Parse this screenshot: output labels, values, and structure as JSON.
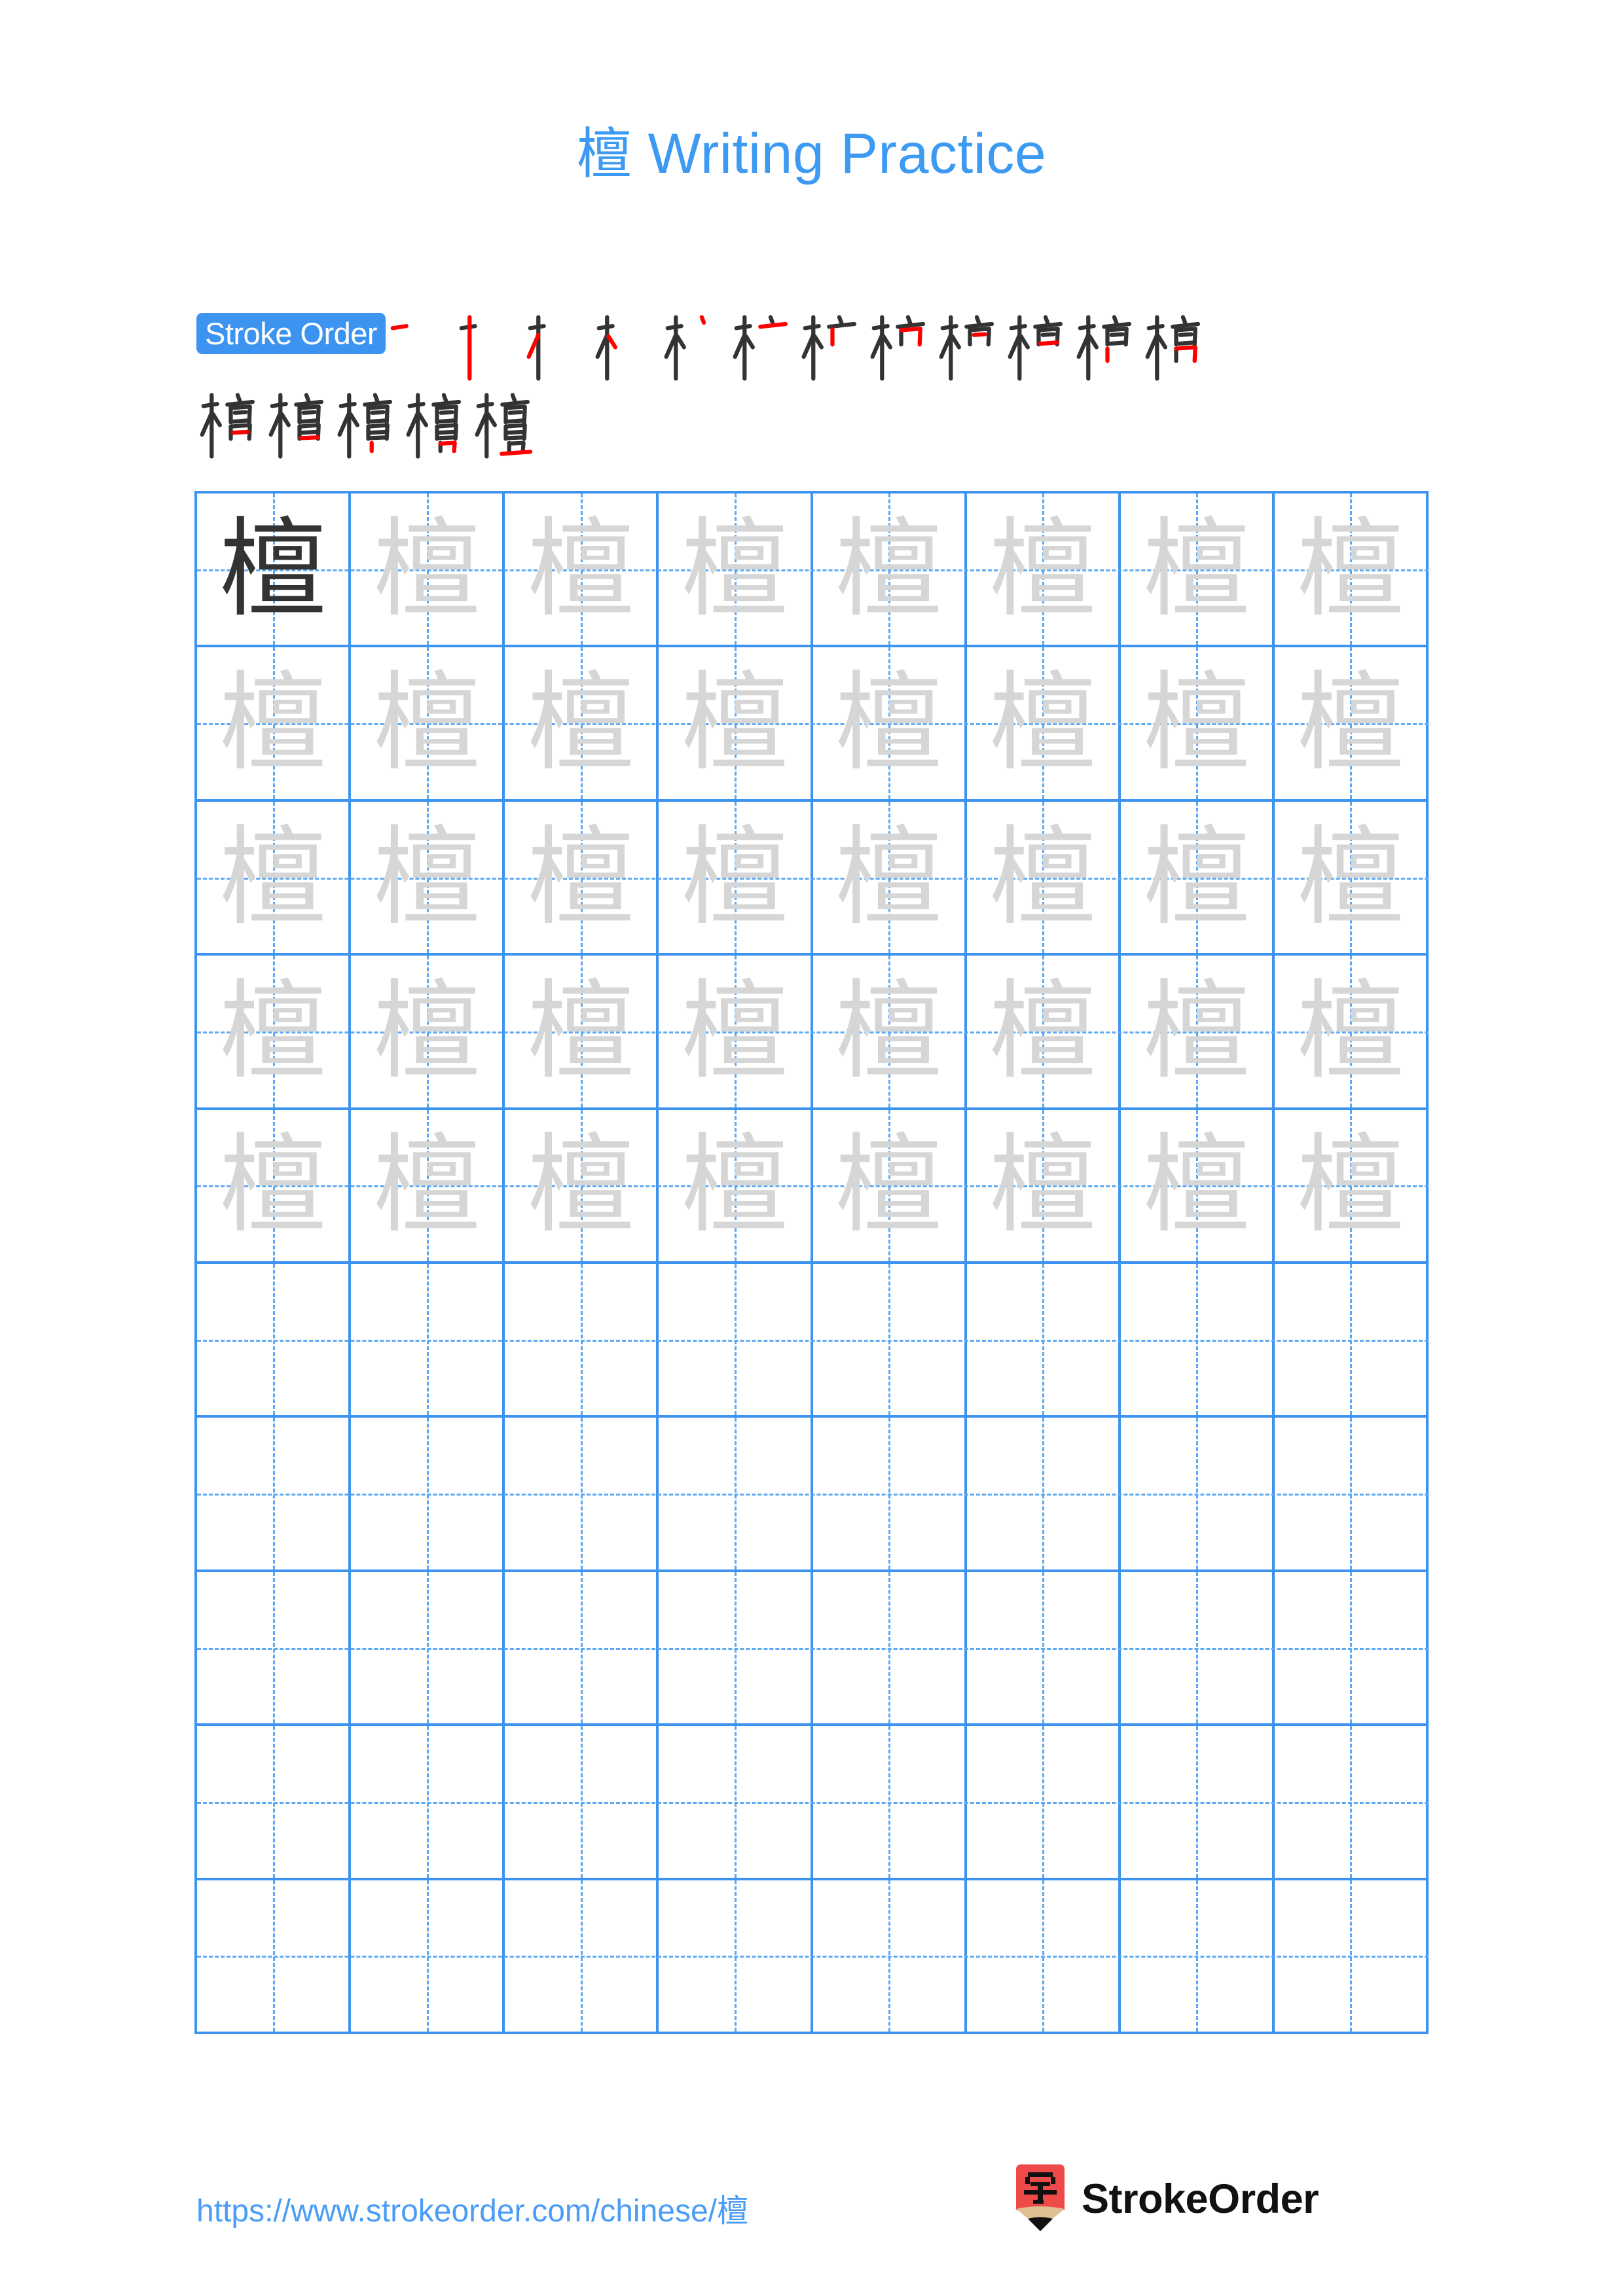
{
  "character": "檀",
  "title": {
    "character": "檀",
    "suffix": " Writing Practice",
    "full": "檀 Writing Practice",
    "color": "#3d9af2"
  },
  "stroke_order": {
    "badge_label": "Stroke Order",
    "badge_bg": "#3d93f0",
    "badge_text_color": "#ffffff",
    "total_strokes": 17,
    "new_stroke_color": "#ff0000",
    "drawn_stroke_color": "#333333",
    "row1_steps": 12,
    "row2_steps": 5,
    "steps": [
      {
        "index": 1,
        "glyph": "一"
      },
      {
        "index": 2,
        "glyph": "十"
      },
      {
        "index": 3,
        "glyph": "才"
      },
      {
        "index": 4,
        "glyph": "木"
      },
      {
        "index": 5,
        "glyph": "木丶"
      },
      {
        "index": 6,
        "glyph": "木亠"
      },
      {
        "index": 7,
        "glyph": "木亠"
      },
      {
        "index": 8,
        "glyph": "杧"
      },
      {
        "index": 9,
        "glyph": "栌"
      },
      {
        "index": 10,
        "glyph": "梅"
      },
      {
        "index": 11,
        "glyph": "楄"
      },
      {
        "index": 12,
        "glyph": "楇"
      },
      {
        "index": 13,
        "glyph": "楈"
      },
      {
        "index": 14,
        "glyph": "楀"
      },
      {
        "index": 15,
        "glyph": "檀"
      },
      {
        "index": 16,
        "glyph": "檀"
      },
      {
        "index": 17,
        "glyph": "檀"
      }
    ]
  },
  "grid": {
    "rows": 10,
    "columns": 8,
    "line_color": "#3d93f0",
    "guide_color": "#5aa9f5",
    "model_char_color": "#333333",
    "trace_char_color": "#d6d6d6",
    "filled_rows": 5,
    "empty_rows": 5,
    "cells": [
      [
        {
          "char": "檀",
          "style": "dark"
        },
        {
          "char": "檀",
          "style": "faint"
        },
        {
          "char": "檀",
          "style": "faint"
        },
        {
          "char": "檀",
          "style": "faint"
        },
        {
          "char": "檀",
          "style": "faint"
        },
        {
          "char": "檀",
          "style": "faint"
        },
        {
          "char": "檀",
          "style": "faint"
        },
        {
          "char": "檀",
          "style": "faint"
        }
      ],
      [
        {
          "char": "檀",
          "style": "faint"
        },
        {
          "char": "檀",
          "style": "faint"
        },
        {
          "char": "檀",
          "style": "faint"
        },
        {
          "char": "檀",
          "style": "faint"
        },
        {
          "char": "檀",
          "style": "faint"
        },
        {
          "char": "檀",
          "style": "faint"
        },
        {
          "char": "檀",
          "style": "faint"
        },
        {
          "char": "檀",
          "style": "faint"
        }
      ],
      [
        {
          "char": "檀",
          "style": "faint"
        },
        {
          "char": "檀",
          "style": "faint"
        },
        {
          "char": "檀",
          "style": "faint"
        },
        {
          "char": "檀",
          "style": "faint"
        },
        {
          "char": "檀",
          "style": "faint"
        },
        {
          "char": "檀",
          "style": "faint"
        },
        {
          "char": "檀",
          "style": "faint"
        },
        {
          "char": "檀",
          "style": "faint"
        }
      ],
      [
        {
          "char": "檀",
          "style": "faint"
        },
        {
          "char": "檀",
          "style": "faint"
        },
        {
          "char": "檀",
          "style": "faint"
        },
        {
          "char": "檀",
          "style": "faint"
        },
        {
          "char": "檀",
          "style": "faint"
        },
        {
          "char": "檀",
          "style": "faint"
        },
        {
          "char": "檀",
          "style": "faint"
        },
        {
          "char": "檀",
          "style": "faint"
        }
      ],
      [
        {
          "char": "檀",
          "style": "faint"
        },
        {
          "char": "檀",
          "style": "faint"
        },
        {
          "char": "檀",
          "style": "faint"
        },
        {
          "char": "檀",
          "style": "faint"
        },
        {
          "char": "檀",
          "style": "faint"
        },
        {
          "char": "檀",
          "style": "faint"
        },
        {
          "char": "檀",
          "style": "faint"
        },
        {
          "char": "檀",
          "style": "faint"
        }
      ],
      [
        {
          "char": "",
          "style": "empty"
        },
        {
          "char": "",
          "style": "empty"
        },
        {
          "char": "",
          "style": "empty"
        },
        {
          "char": "",
          "style": "empty"
        },
        {
          "char": "",
          "style": "empty"
        },
        {
          "char": "",
          "style": "empty"
        },
        {
          "char": "",
          "style": "empty"
        },
        {
          "char": "",
          "style": "empty"
        }
      ],
      [
        {
          "char": "",
          "style": "empty"
        },
        {
          "char": "",
          "style": "empty"
        },
        {
          "char": "",
          "style": "empty"
        },
        {
          "char": "",
          "style": "empty"
        },
        {
          "char": "",
          "style": "empty"
        },
        {
          "char": "",
          "style": "empty"
        },
        {
          "char": "",
          "style": "empty"
        },
        {
          "char": "",
          "style": "empty"
        }
      ],
      [
        {
          "char": "",
          "style": "empty"
        },
        {
          "char": "",
          "style": "empty"
        },
        {
          "char": "",
          "style": "empty"
        },
        {
          "char": "",
          "style": "empty"
        },
        {
          "char": "",
          "style": "empty"
        },
        {
          "char": "",
          "style": "empty"
        },
        {
          "char": "",
          "style": "empty"
        },
        {
          "char": "",
          "style": "empty"
        }
      ],
      [
        {
          "char": "",
          "style": "empty"
        },
        {
          "char": "",
          "style": "empty"
        },
        {
          "char": "",
          "style": "empty"
        },
        {
          "char": "",
          "style": "empty"
        },
        {
          "char": "",
          "style": "empty"
        },
        {
          "char": "",
          "style": "empty"
        },
        {
          "char": "",
          "style": "empty"
        },
        {
          "char": "",
          "style": "empty"
        }
      ],
      [
        {
          "char": "",
          "style": "empty"
        },
        {
          "char": "",
          "style": "empty"
        },
        {
          "char": "",
          "style": "empty"
        },
        {
          "char": "",
          "style": "empty"
        },
        {
          "char": "",
          "style": "empty"
        },
        {
          "char": "",
          "style": "empty"
        },
        {
          "char": "",
          "style": "empty"
        },
        {
          "char": "",
          "style": "empty"
        }
      ]
    ]
  },
  "footer": {
    "url": "https://www.strokeorder.com/chinese/檀",
    "url_color": "#4a9cf5",
    "brand_name": "StrokeOrder",
    "brand_icon_char": "字",
    "brand_icon_bg": "#ef4a4a",
    "brand_icon_wood": "#dfbf94",
    "brand_icon_tip": "#111111"
  }
}
